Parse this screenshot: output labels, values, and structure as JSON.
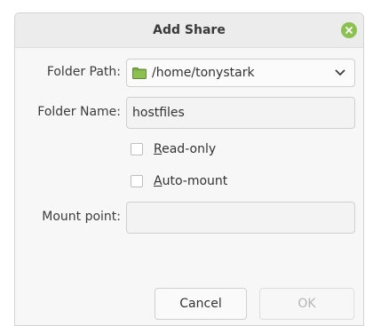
{
  "dialog": {
    "title": "Add Share",
    "close_icon": "close-icon",
    "accent_color": "#8cc152"
  },
  "form": {
    "folder_path_label": "Folder Path:",
    "folder_path_value": "/home/tonystark",
    "folder_icon": "folder-icon",
    "folder_name_label": "Folder Name:",
    "folder_name_value": "hostfiles",
    "readonly_prefix": "R",
    "readonly_rest": "ead-only",
    "readonly_checked": false,
    "automount_prefix": "A",
    "automount_rest": "uto-mount",
    "automount_checked": false,
    "mount_point_label": "Mount point:",
    "mount_point_value": ""
  },
  "buttons": {
    "cancel": "Cancel",
    "ok": "OK"
  }
}
